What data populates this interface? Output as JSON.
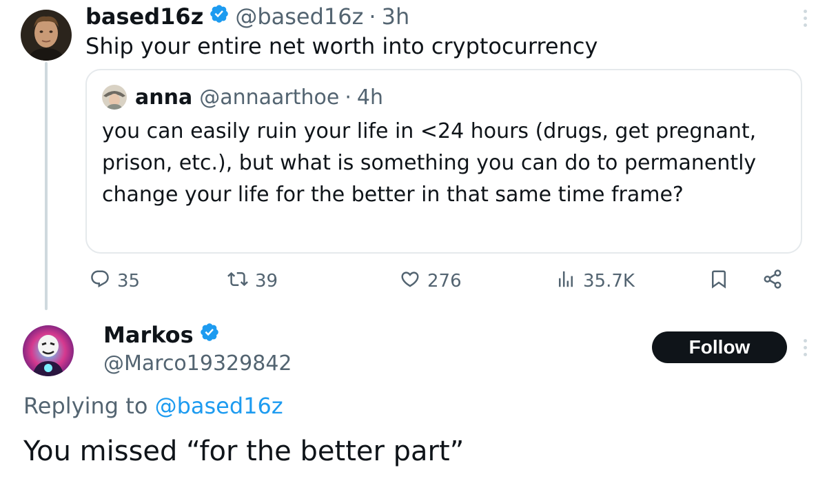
{
  "colors": {
    "verified": "#1d9bf0",
    "text_primary": "#0f1419",
    "text_secondary": "#536471",
    "link": "#1d9bf0",
    "follow_button_bg": "#0f1419",
    "border": "#e5e9ec"
  },
  "tweet": {
    "author_name": "based16z",
    "author_handle": "@based16z",
    "separator": "·",
    "time": "3h",
    "text": "Ship your entire net worth into cryptocurrency",
    "quote": {
      "author_name": "anna",
      "author_handle": "@annaarthoe",
      "separator": "·",
      "time": "4h",
      "text": "you can easily ruin your life in <24 hours (drugs, get pregnant, prison, etc.), but what is something you can do to permanently change your life for the better in that same time frame?"
    },
    "stats": {
      "replies": "35",
      "reposts": "39",
      "likes": "276",
      "views": "35.7K"
    },
    "icons": [
      "reply-icon",
      "repost-icon",
      "like-icon",
      "views-icon",
      "bookmark-icon",
      "share-icon",
      "more-icon"
    ]
  },
  "reply": {
    "author_name": "Markos",
    "author_handle": "@Marco19329842",
    "follow_label": "Follow",
    "replying_prefix": "Replying to",
    "replying_to": "@based16z",
    "text": "You missed “for the better part”"
  }
}
